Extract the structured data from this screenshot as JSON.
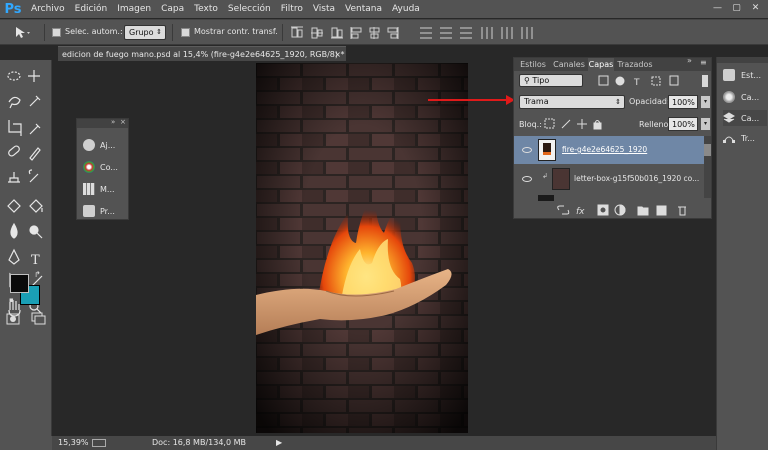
{
  "app": {
    "logo": "Ps"
  },
  "menu": [
    "Archivo",
    "Edición",
    "Imagen",
    "Capa",
    "Texto",
    "Selección",
    "Filtro",
    "Vista",
    "Ventana",
    "Ayuda"
  ],
  "window_controls": [
    "—",
    "▢",
    "✕"
  ],
  "options": {
    "auto_select_label": "Selec. autom.:",
    "auto_select_value": "Grupo",
    "transform_label": "Mostrar contr. transf."
  },
  "doc_tab": {
    "title": "edicion de fuego mano.psd al 15,4% (fire-g4e2e64625_1920, RGB/8) *",
    "close": "×"
  },
  "small_panel": {
    "items": [
      {
        "label": "Aj...",
        "icon": "adjustments-icon"
      },
      {
        "label": "Co...",
        "icon": "color-palette-icon"
      },
      {
        "label": "M...",
        "icon": "swatches-grid-icon"
      },
      {
        "label": "Pr...",
        "icon": "properties-icon"
      }
    ]
  },
  "layers_panel": {
    "tabs": [
      "Estilos",
      "Canales",
      "Capas",
      "Trazados"
    ],
    "active_tab": "Capas",
    "filter_label": "Tipo",
    "blend_mode": "Trama",
    "opacity_label": "Opacidad:",
    "opacity_value": "100%",
    "lock_label": "Bloq.:",
    "fill_label": "Relleno:",
    "fill_value": "100%",
    "layers": [
      {
        "name": "fire-g4e2e64625_1920",
        "selected": true
      },
      {
        "name": "letter-box-g15f50b016_1920 co...",
        "selected": false
      }
    ]
  },
  "right_dock": {
    "items": [
      {
        "label": "Est...",
        "icon": "styles-icon"
      },
      {
        "label": "Ca...",
        "icon": "channels-icon"
      },
      {
        "label": "Ca...",
        "icon": "layers-icon"
      },
      {
        "label": "Tr...",
        "icon": "paths-icon"
      }
    ]
  },
  "status": {
    "zoom": "15,39%",
    "doc": "Doc: 16,8 MB/134,0 MB"
  },
  "colors": {
    "foreground": "#0a0a0a",
    "background": "#1a9fb5",
    "accent_arrow": "#e01a1a",
    "selected_layer": "#6f87a6"
  }
}
